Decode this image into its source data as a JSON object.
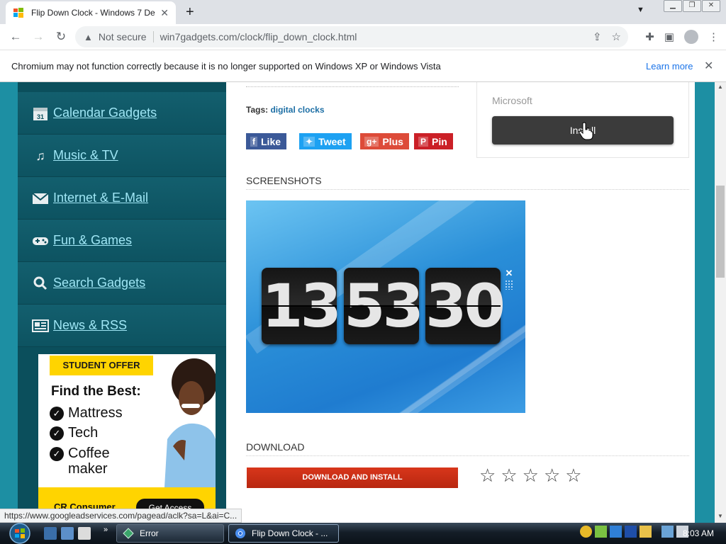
{
  "browser": {
    "tab_title": "Flip Down Clock - Windows 7 De",
    "security_label": "Not secure",
    "url": "win7gadgets.com/clock/flip_down_clock.html",
    "infobar_text": "Chromium may not function correctly because it is no longer supported on Windows XP or Windows Vista",
    "learn_more": "Learn more"
  },
  "sidebar": {
    "items": [
      {
        "label": "Calendar Gadgets",
        "icon": "calendar-icon"
      },
      {
        "label": "Music & TV",
        "icon": "music-note-icon"
      },
      {
        "label": "Internet & E-Mail",
        "icon": "envelope-icon"
      },
      {
        "label": "Fun & Games",
        "icon": "gamepad-icon"
      },
      {
        "label": "Search Gadgets",
        "icon": "magnifier-icon"
      },
      {
        "label": "News & RSS",
        "icon": "newspaper-icon"
      }
    ]
  },
  "ad": {
    "badge": "STUDENT OFFER",
    "headline": "Find the Best:",
    "items": [
      "Mattress",
      "Tech",
      "Coffee",
      "maker"
    ],
    "brand": "CR Consumer",
    "cta": "Get Access"
  },
  "main": {
    "tags_label": "Tags:",
    "tag": "digital clocks",
    "social": {
      "like": "Like",
      "tweet": "Tweet",
      "plus": "Plus",
      "pin": "Pin"
    },
    "publisher": "Microsoft",
    "install_label": "Install",
    "screenshots_title": "SCREENSHOTS",
    "clock_digits": [
      "13",
      "53",
      "30"
    ],
    "download_title": "DOWNLOAD",
    "download_button": "DOWNLOAD AND INSTALL",
    "rating_stars": 0
  },
  "status_url": "https://www.googleadservices.com/pagead/aclk?sa=L&ai=C...",
  "taskbar": {
    "tasks": [
      {
        "label": "Error"
      },
      {
        "label": "Flip Down Clock - ..."
      }
    ],
    "clock": "8:03 AM"
  },
  "colors": {
    "page_bg": "#1d8fa3",
    "sidebar_bg": "#0b4f5c",
    "sidebar_link": "#9fe6f5",
    "download_red": "#c9301a",
    "facebook": "#3b5998",
    "twitter": "#1da1f2",
    "google_plus": "#dd4b39",
    "pinterest": "#cb2027"
  }
}
